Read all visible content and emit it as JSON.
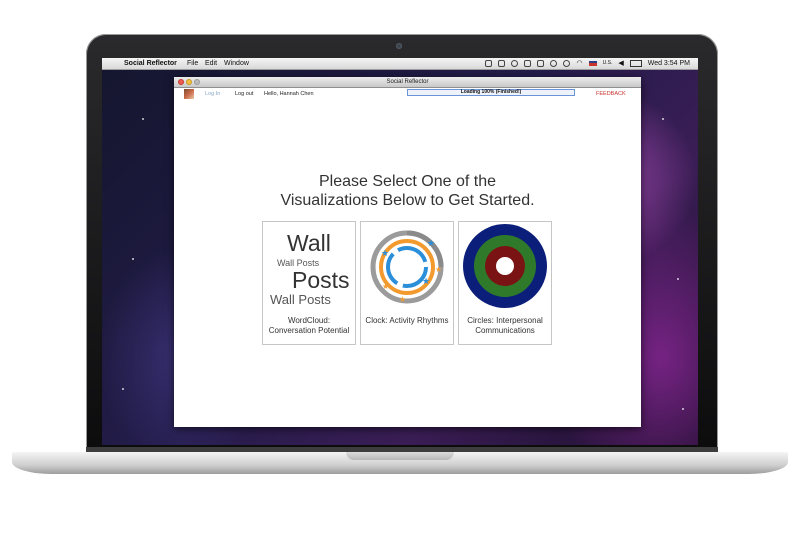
{
  "menubar": {
    "apple_icon": "apple-icon",
    "app_name": "Social Reflector",
    "menus": [
      "File",
      "Edit",
      "Window"
    ],
    "flag_label": "U.S.",
    "clock": "Wed 3:54 PM"
  },
  "window": {
    "title": "Social Reflector",
    "login": "Log In",
    "logout": "Log out",
    "greeting": "Hello, Hannah Chen",
    "progress_text": "Loading 100% (Finished!)",
    "progress_value": 1.0,
    "feedback": "FEEDBACK"
  },
  "main": {
    "heading_line1": "Please Select One of the",
    "heading_line2": "Visualizations Below to Get Started."
  },
  "cards": [
    {
      "caption_line1": "WordCloud:",
      "caption_line2": "Conversation Potential",
      "words": [
        "Wall",
        "Wall Posts",
        "Posts",
        "Wall Posts"
      ]
    },
    {
      "caption_line1": "Clock: Activity Rhythms"
    },
    {
      "caption_line1": "Circles: Interpersonal",
      "caption_line2": "Communications"
    }
  ],
  "colors": {
    "feedback": "#c8332c",
    "progress_border": "#6b94d8",
    "clock_blue": "#2a8fd8",
    "clock_orange": "#f29a2e",
    "ring_navy": "#0b1f7a",
    "ring_green": "#2f7a2a",
    "ring_maroon": "#7a1414"
  }
}
